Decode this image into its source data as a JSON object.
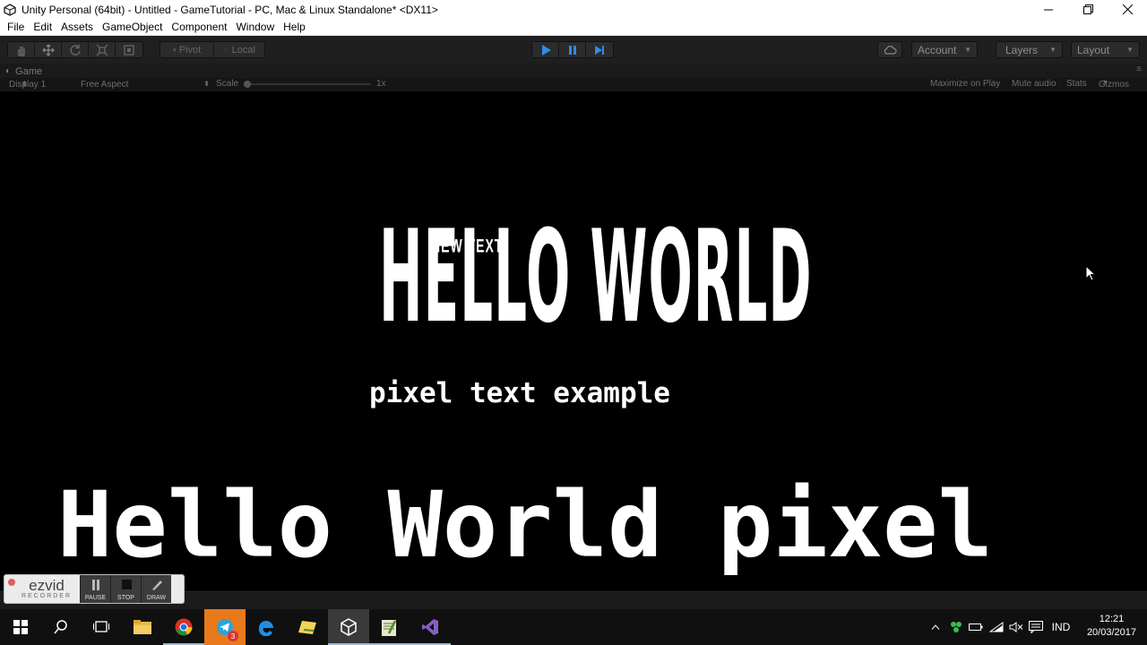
{
  "window": {
    "title": "Unity Personal (64bit) - Untitled - GameTutorial - PC, Mac & Linux Standalone* <DX11>",
    "controls": [
      "minimize-icon",
      "restore-icon",
      "close-icon"
    ]
  },
  "menu": {
    "items": [
      "File",
      "Edit",
      "Assets",
      "GameObject",
      "Component",
      "Window",
      "Help"
    ]
  },
  "toolbar": {
    "pivot_label": "Pivot",
    "local_label": "Local",
    "account_label": "Account",
    "layers_label": "Layers",
    "layout_label": "Layout",
    "play_color": "#2f8be8"
  },
  "game_panel": {
    "tab_label": "Game",
    "display_label": "Display 1",
    "aspect_label": "Free Aspect",
    "scale_label": "Scale",
    "scale_value": "1x",
    "maximize_label": "Maximize on Play",
    "mute_label": "Mute audio",
    "stats_label": "Stats",
    "gizmos_label": "Gizmos"
  },
  "game_view": {
    "hello_world": "HELLO WORLD",
    "new_text": "NEW TEXT",
    "pixel_small": "pixel text example",
    "pixel_big": "Hello World pixel"
  },
  "ezvid": {
    "brand": "ezvid",
    "sub": "RECORDER",
    "pause_label": "PAUSE",
    "stop_label": "STOP",
    "draw_label": "DRAW"
  },
  "taskbar": {
    "badge": "3",
    "language": "IND",
    "time": "12:21",
    "date": "20/03/2017"
  }
}
